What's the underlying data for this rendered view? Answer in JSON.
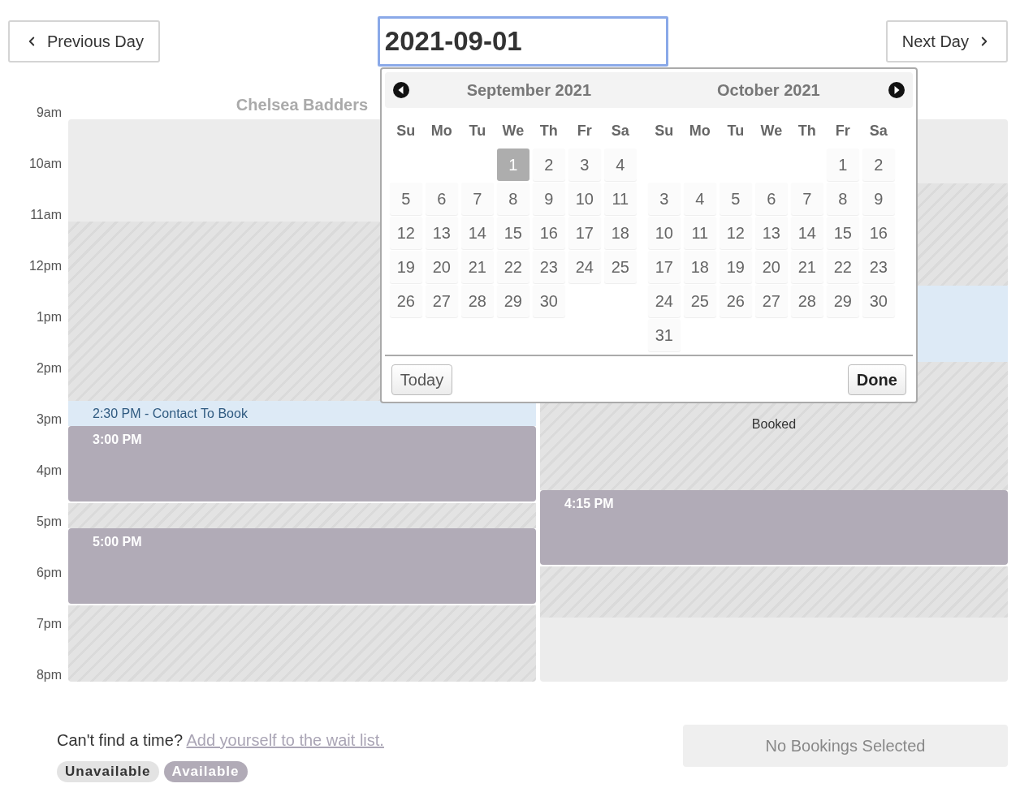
{
  "nav": {
    "previous": "Previous Day",
    "next": "Next Day",
    "date_value": "2021-09-01"
  },
  "hours": [
    "9am",
    "10am",
    "11am",
    "12pm",
    "1pm",
    "2pm",
    "3pm",
    "4pm",
    "5pm",
    "6pm",
    "7pm",
    "8pm"
  ],
  "columns": [
    {
      "title": "Chelsea Badders",
      "blocks": [
        {
          "kind": "available"
        },
        {
          "kind": "unavailable"
        },
        {
          "kind": "notice",
          "label": "2:30 PM - Contact To Book"
        },
        {
          "kind": "booked",
          "label": "3:00 PM"
        },
        {
          "kind": "unavailable"
        },
        {
          "kind": "booked",
          "label": "5:00 PM"
        },
        {
          "kind": "unavailable"
        }
      ]
    },
    {
      "blocks": [
        {
          "kind": "available"
        },
        {
          "kind": "unavailable"
        },
        {
          "kind": "notice"
        },
        {
          "kind": "unavailable",
          "label": "Booked"
        },
        {
          "kind": "booked",
          "label": "4:15 PM"
        },
        {
          "kind": "unavailable"
        },
        {
          "kind": "available"
        }
      ]
    }
  ],
  "datepicker": {
    "today": "Today",
    "done": "Done",
    "months": [
      {
        "title": "September 2021",
        "weekdays": [
          "Su",
          "Mo",
          "Tu",
          "We",
          "Th",
          "Fr",
          "Sa"
        ],
        "weeks": [
          [
            {
              "kind": "blank"
            },
            {
              "kind": "blank"
            },
            {
              "kind": "blank"
            },
            {
              "kind": "day",
              "day": "1",
              "selected": true
            },
            {
              "kind": "day",
              "day": "2",
              "selected": false
            },
            {
              "kind": "day",
              "day": "3",
              "selected": false
            },
            {
              "kind": "day",
              "day": "4",
              "selected": false
            }
          ],
          [
            {
              "kind": "day",
              "day": "5",
              "selected": false
            },
            {
              "kind": "day",
              "day": "6",
              "selected": false
            },
            {
              "kind": "day",
              "day": "7",
              "selected": false
            },
            {
              "kind": "day",
              "day": "8",
              "selected": false
            },
            {
              "kind": "day",
              "day": "9",
              "selected": false
            },
            {
              "kind": "day",
              "day": "10",
              "selected": false
            },
            {
              "kind": "day",
              "day": "11",
              "selected": false
            }
          ],
          [
            {
              "kind": "day",
              "day": "12",
              "selected": false
            },
            {
              "kind": "day",
              "day": "13",
              "selected": false
            },
            {
              "kind": "day",
              "day": "14",
              "selected": false
            },
            {
              "kind": "day",
              "day": "15",
              "selected": false
            },
            {
              "kind": "day",
              "day": "16",
              "selected": false
            },
            {
              "kind": "day",
              "day": "17",
              "selected": false
            },
            {
              "kind": "day",
              "day": "18",
              "selected": false
            }
          ],
          [
            {
              "kind": "day",
              "day": "19",
              "selected": false
            },
            {
              "kind": "day",
              "day": "20",
              "selected": false
            },
            {
              "kind": "day",
              "day": "21",
              "selected": false
            },
            {
              "kind": "day",
              "day": "22",
              "selected": false
            },
            {
              "kind": "day",
              "day": "23",
              "selected": false
            },
            {
              "kind": "day",
              "day": "24",
              "selected": false
            },
            {
              "kind": "day",
              "day": "25",
              "selected": false
            }
          ],
          [
            {
              "kind": "day",
              "day": "26",
              "selected": false
            },
            {
              "kind": "day",
              "day": "27",
              "selected": false
            },
            {
              "kind": "day",
              "day": "28",
              "selected": false
            },
            {
              "kind": "day",
              "day": "29",
              "selected": false
            },
            {
              "kind": "day",
              "day": "30",
              "selected": false
            },
            {
              "kind": "blank"
            },
            {
              "kind": "blank"
            }
          ]
        ]
      },
      {
        "title": "October 2021",
        "weekdays": [
          "Su",
          "Mo",
          "Tu",
          "We",
          "Th",
          "Fr",
          "Sa"
        ],
        "weeks": [
          [
            {
              "kind": "blank"
            },
            {
              "kind": "blank"
            },
            {
              "kind": "blank"
            },
            {
              "kind": "blank"
            },
            {
              "kind": "blank"
            },
            {
              "kind": "day",
              "day": "1",
              "selected": false
            },
            {
              "kind": "day",
              "day": "2",
              "selected": false
            }
          ],
          [
            {
              "kind": "day",
              "day": "3",
              "selected": false
            },
            {
              "kind": "day",
              "day": "4",
              "selected": false
            },
            {
              "kind": "day",
              "day": "5",
              "selected": false
            },
            {
              "kind": "day",
              "day": "6",
              "selected": false
            },
            {
              "kind": "day",
              "day": "7",
              "selected": false
            },
            {
              "kind": "day",
              "day": "8",
              "selected": false
            },
            {
              "kind": "day",
              "day": "9",
              "selected": false
            }
          ],
          [
            {
              "kind": "day",
              "day": "10",
              "selected": false
            },
            {
              "kind": "day",
              "day": "11",
              "selected": false
            },
            {
              "kind": "day",
              "day": "12",
              "selected": false
            },
            {
              "kind": "day",
              "day": "13",
              "selected": false
            },
            {
              "kind": "day",
              "day": "14",
              "selected": false
            },
            {
              "kind": "day",
              "day": "15",
              "selected": false
            },
            {
              "kind": "day",
              "day": "16",
              "selected": false
            }
          ],
          [
            {
              "kind": "day",
              "day": "17",
              "selected": false
            },
            {
              "kind": "day",
              "day": "18",
              "selected": false
            },
            {
              "kind": "day",
              "day": "19",
              "selected": false
            },
            {
              "kind": "day",
              "day": "20",
              "selected": false
            },
            {
              "kind": "day",
              "day": "21",
              "selected": false
            },
            {
              "kind": "day",
              "day": "22",
              "selected": false
            },
            {
              "kind": "day",
              "day": "23",
              "selected": false
            }
          ],
          [
            {
              "kind": "day",
              "day": "24",
              "selected": false
            },
            {
              "kind": "day",
              "day": "25",
              "selected": false
            },
            {
              "kind": "day",
              "day": "26",
              "selected": false
            },
            {
              "kind": "day",
              "day": "27",
              "selected": false
            },
            {
              "kind": "day",
              "day": "28",
              "selected": false
            },
            {
              "kind": "day",
              "day": "29",
              "selected": false
            },
            {
              "kind": "day",
              "day": "30",
              "selected": false
            }
          ],
          [
            {
              "kind": "day",
              "day": "31",
              "selected": false
            },
            {
              "kind": "blank"
            },
            {
              "kind": "blank"
            },
            {
              "kind": "blank"
            },
            {
              "kind": "blank"
            },
            {
              "kind": "blank"
            },
            {
              "kind": "blank"
            }
          ]
        ]
      }
    ]
  },
  "footer": {
    "prompt": "Can't find a time?",
    "link": "Add yourself to the wait list.",
    "summary": "No Bookings Selected",
    "legend": [
      {
        "kind": "unavailable",
        "label": "Unavailable"
      },
      {
        "kind": "available",
        "label": "Available"
      }
    ]
  }
}
